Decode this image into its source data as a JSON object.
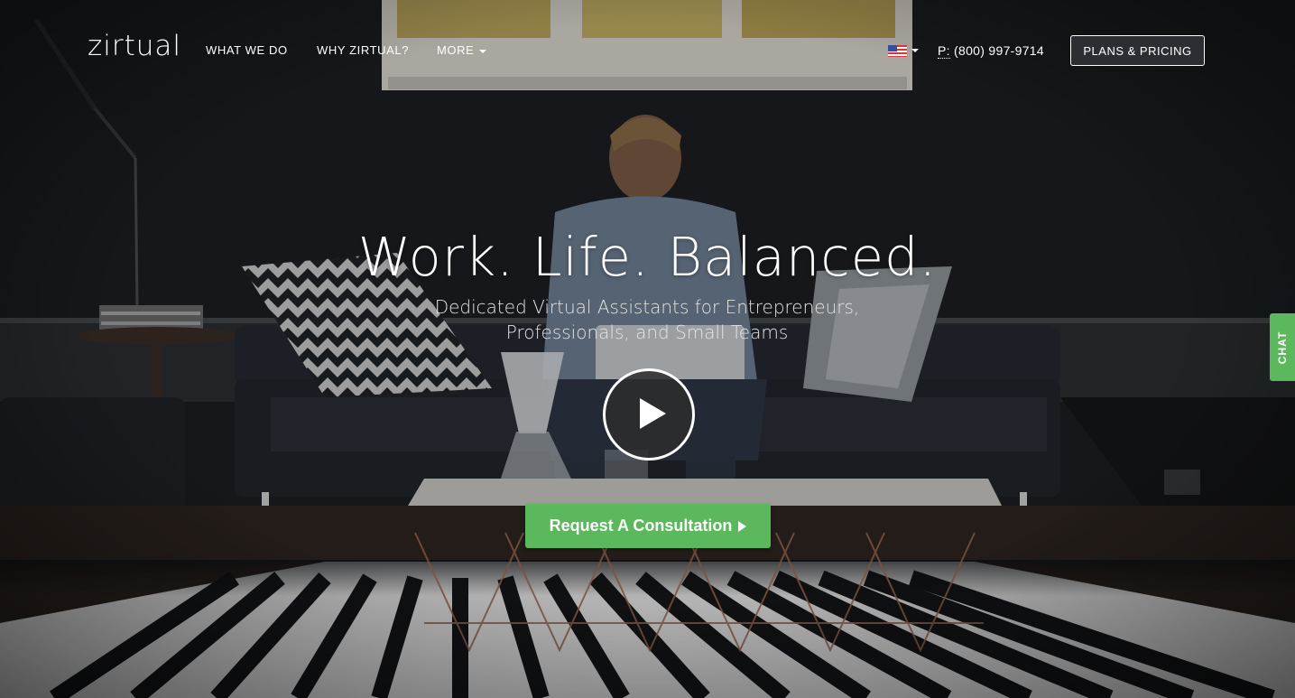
{
  "nav": {
    "logo": "zirtual",
    "links": [
      "WHAT WE DO",
      "WHY ZIRTUAL?",
      "MORE"
    ],
    "flag_icon": "us-flag-icon",
    "phone_label": "P:",
    "phone_number": "(800) 997-9714",
    "plans_button": "PLANS & PRICING"
  },
  "hero": {
    "headline": "Work. Life. Balanced.",
    "subhead_line1": "Dedicated Virtual Assistants for Entrepreneurs,",
    "subhead_line2": "Professionals, and Small Teams",
    "play_icon": "play-icon",
    "cta_label": "Request A Consultation"
  },
  "chat": {
    "label": "CHAT"
  },
  "colors": {
    "accent_green": "#5cb85c",
    "text": "#ffffff"
  }
}
